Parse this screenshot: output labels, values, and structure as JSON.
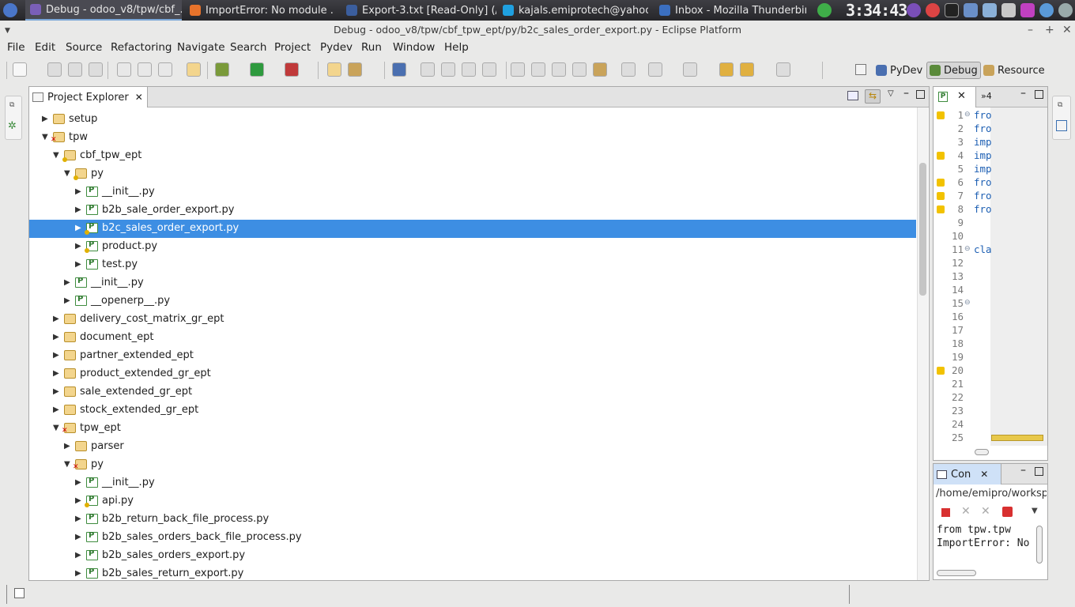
{
  "taskbar": {
    "items": [
      {
        "label": "Debug - odoo_v8/tpw/cbf_...",
        "active": true,
        "icon": "eclipse-icon"
      },
      {
        "label": "ImportError: No module ...",
        "active": false,
        "icon": "firefox-icon"
      },
      {
        "label": "Export-3.txt [Read-Only] (/...",
        "active": false,
        "icon": "text-editor-icon"
      },
      {
        "label": "kajals.emiprotech@yahoo....",
        "active": false,
        "icon": "skype-icon"
      },
      {
        "label": "Inbox - Mozilla Thunderbird",
        "active": false,
        "icon": "thunderbird-icon"
      }
    ],
    "clock": "3:34:43"
  },
  "window": {
    "title": "Debug - odoo_v8/tpw/cbf_tpw_ept/py/b2c_sales_order_export.py - Eclipse Platform"
  },
  "menu": [
    "File",
    "Edit",
    "Source",
    "Refactoring",
    "Navigate",
    "Search",
    "Project",
    "Pydev",
    "Run",
    "Window",
    "Help"
  ],
  "perspectives": [
    {
      "label": "PyDev",
      "active": false
    },
    {
      "label": "Debug",
      "active": true
    },
    {
      "label": "Resource",
      "active": false
    }
  ],
  "explorer": {
    "tab_label": "Project Explorer",
    "rows": [
      {
        "label": "setup",
        "kind": "folder",
        "depth": 0,
        "expanded": false
      },
      {
        "label": "tpw",
        "kind": "project-error",
        "depth": 0,
        "expanded": true
      },
      {
        "label": "cbf_tpw_ept",
        "kind": "package-warn",
        "depth": 1,
        "expanded": true
      },
      {
        "label": "py",
        "kind": "package-warn",
        "depth": 2,
        "expanded": true
      },
      {
        "label": "__init__.py",
        "kind": "pyfile",
        "depth": 3,
        "expanded": false
      },
      {
        "label": "b2b_sale_order_export.py",
        "kind": "pyfile",
        "depth": 3,
        "expanded": false
      },
      {
        "label": "b2c_sales_order_export.py",
        "kind": "pyfile-warn",
        "depth": 3,
        "expanded": false,
        "selected": true
      },
      {
        "label": "product.py",
        "kind": "pyfile-warn",
        "depth": 3,
        "expanded": false
      },
      {
        "label": "test.py",
        "kind": "pyfile",
        "depth": 3,
        "expanded": false
      },
      {
        "label": "__init__.py",
        "kind": "pyfile",
        "depth": 2,
        "expanded": false
      },
      {
        "label": "__openerp__.py",
        "kind": "pyfile",
        "depth": 2,
        "expanded": false
      },
      {
        "label": "delivery_cost_matrix_gr_ept",
        "kind": "folder",
        "depth": 1,
        "expanded": false
      },
      {
        "label": "document_ept",
        "kind": "folder",
        "depth": 1,
        "expanded": false
      },
      {
        "label": "partner_extended_ept",
        "kind": "folder",
        "depth": 1,
        "expanded": false
      },
      {
        "label": "product_extended_gr_ept",
        "kind": "folder",
        "depth": 1,
        "expanded": false
      },
      {
        "label": "sale_extended_gr_ept",
        "kind": "folder",
        "depth": 1,
        "expanded": false
      },
      {
        "label": "stock_extended_gr_ept",
        "kind": "folder",
        "depth": 1,
        "expanded": false
      },
      {
        "label": "tpw_ept",
        "kind": "package-error",
        "depth": 1,
        "expanded": true
      },
      {
        "label": "parser",
        "kind": "folder",
        "depth": 2,
        "expanded": false
      },
      {
        "label": "py",
        "kind": "package-error",
        "depth": 2,
        "expanded": true
      },
      {
        "label": "__init__.py",
        "kind": "pyfile",
        "depth": 3,
        "expanded": false
      },
      {
        "label": "api.py",
        "kind": "pyfile-warn",
        "depth": 3,
        "expanded": false
      },
      {
        "label": "b2b_return_back_file_process.py",
        "kind": "pyfile",
        "depth": 3,
        "expanded": false
      },
      {
        "label": "b2b_sales_orders_back_file_process.py",
        "kind": "pyfile",
        "depth": 3,
        "expanded": false
      },
      {
        "label": "b2b_sales_orders_export.py",
        "kind": "pyfile",
        "depth": 3,
        "expanded": false
      },
      {
        "label": "b2b_sales_return_export.py",
        "kind": "pyfile",
        "depth": 3,
        "expanded": false
      }
    ]
  },
  "editor": {
    "tab_count": "»4",
    "lines": [
      {
        "num": "1",
        "code": "fro",
        "warn": true,
        "fold": true
      },
      {
        "num": "2",
        "code": "fro",
        "warn": false
      },
      {
        "num": "3",
        "code": "imp",
        "warn": false
      },
      {
        "num": "4",
        "code": "imp",
        "warn": true
      },
      {
        "num": "5",
        "code": "imp",
        "warn": false
      },
      {
        "num": "6",
        "code": "fro",
        "warn": true
      },
      {
        "num": "7",
        "code": "fro",
        "warn": true
      },
      {
        "num": "8",
        "code": "fro",
        "warn": true
      },
      {
        "num": "9",
        "code": "",
        "warn": false
      },
      {
        "num": "10",
        "code": "",
        "warn": false
      },
      {
        "num": "11",
        "code": "cla",
        "warn": false,
        "fold": true
      },
      {
        "num": "12",
        "code": "",
        "warn": false
      },
      {
        "num": "13",
        "code": "",
        "warn": false
      },
      {
        "num": "14",
        "code": "",
        "warn": false
      },
      {
        "num": "15",
        "code": "",
        "warn": false,
        "fold": true
      },
      {
        "num": "16",
        "code": "",
        "warn": false
      },
      {
        "num": "17",
        "code": "",
        "warn": false
      },
      {
        "num": "18",
        "code": "",
        "warn": false
      },
      {
        "num": "19",
        "code": "",
        "warn": false
      },
      {
        "num": "20",
        "code": "",
        "warn": true
      },
      {
        "num": "21",
        "code": "",
        "warn": false
      },
      {
        "num": "22",
        "code": "",
        "warn": false
      },
      {
        "num": "23",
        "code": "",
        "warn": false
      },
      {
        "num": "24",
        "code": "",
        "warn": false
      },
      {
        "num": "25",
        "code": "",
        "warn": false
      }
    ]
  },
  "console": {
    "tab_label": "Con",
    "path": "/home/emipro/workspa",
    "lines": [
      "   from tpw.tpw",
      "ImportError: No"
    ]
  },
  "colors": {
    "selection": "#3d8ee3",
    "warning": "#f2c200",
    "error": "#d00000",
    "python_green": "#3e8c3e"
  }
}
